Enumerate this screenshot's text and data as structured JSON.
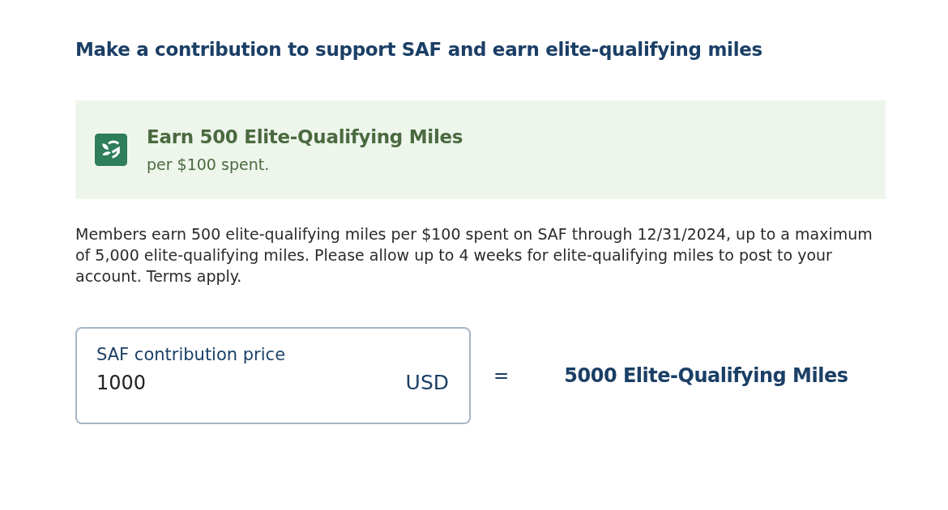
{
  "heading": "Make a contribution to support SAF and earn elite-qualifying miles",
  "banner": {
    "title": "Earn 500 Elite-Qualifying Miles",
    "subtitle": "per $100 spent."
  },
  "description": "Members earn 500 elite-qualifying miles per $100 spent on SAF through 12/31/2024, up to a maximum of 5,000 elite-qualifying miles. Please allow up to 4 weeks for elite-qualifying miles to post to your account. Terms apply.",
  "price_field": {
    "label": "SAF contribution price",
    "value": "1000",
    "currency": "USD"
  },
  "equals": "=",
  "result": "5000 Elite-Qualifying Miles"
}
